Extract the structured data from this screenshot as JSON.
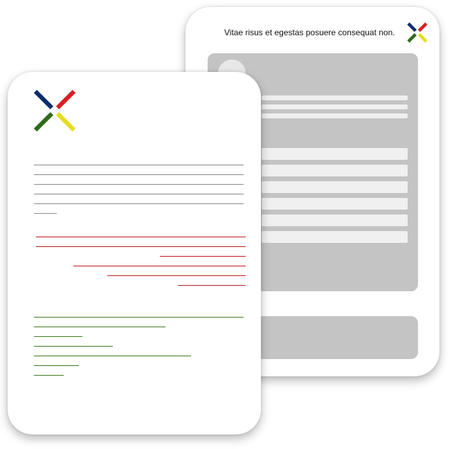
{
  "back_card": {
    "caption": "Vitae risus et egestas posuere consequat non.",
    "logo_icon": "four-color-x-logo"
  },
  "front_card": {
    "logo_icon": "four-color-x-logo"
  },
  "colors": {
    "logo_blue": "#0e2c6e",
    "logo_red": "#d81f1f",
    "logo_green": "#2f6a17",
    "logo_yellow": "#e6dd1e",
    "panel_gray": "#c4c4c4",
    "text_line_gray": "#8a8a8a",
    "text_line_red": "#c21818",
    "text_line_green": "#3c7a1c"
  }
}
